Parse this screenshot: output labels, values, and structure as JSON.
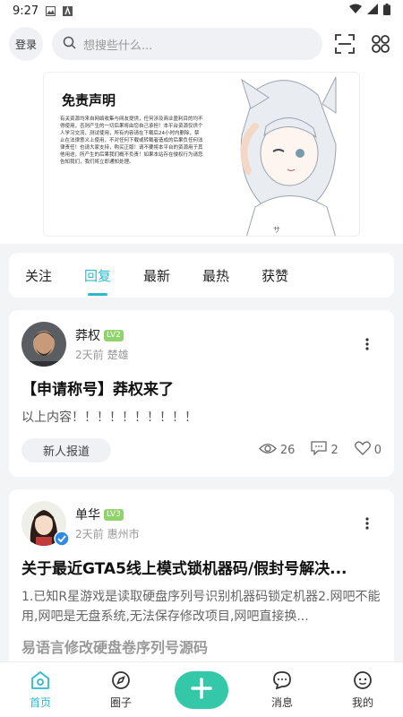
{
  "status": {
    "time": "9:27"
  },
  "header": {
    "login_label": "登录",
    "search_placeholder": "想搜些什么..."
  },
  "banner": {
    "title": "免责声明",
    "body": "有关资源均来自网络收集与网友提供，任何涉及商业盈利目的均不得使用，否则产生的一切后果将由您自己承担！本平台资源仅供个人学习交流、测试使用，所有内容请在下载后24小时内删除，禁止在法律意义上使用，不对任何下载或转载者造成的后果负任何法律责任！也请大家支持，购买正版！请不要将本平台的资源用于其他用途，所产生的后果我们概不负责！如果本站存在侵权行为请您告知我们，我们将立即通知处理。"
  },
  "tabs": [
    {
      "label": "关注"
    },
    {
      "label": "回复"
    },
    {
      "label": "最新"
    },
    {
      "label": "最热"
    },
    {
      "label": "获赞"
    }
  ],
  "active_tab": "回复",
  "posts": [
    {
      "author": "莽权",
      "level": "LV2",
      "time": "2天前",
      "location": "楚雄",
      "title": "【申请称号】莽权来了",
      "body": "以上内容！！！！！！！！！！",
      "tag": "新人报道",
      "views": "26",
      "comments": "2",
      "likes": "0"
    },
    {
      "author": "单华",
      "level": "LV3",
      "time": "2天前",
      "location": "惠州市",
      "title": "关于最近GTA5线上模式锁机器码/假封号解决...",
      "body": "1.已知R星游戏是读取硬盘序列号识别机器码锁定机器2.网吧不能用,网吧是无盘系统,无法保存修改项目,网吧直接换...",
      "subtitle": "易语言修改硬盘卷序列号源码"
    }
  ],
  "bottom_nav": [
    {
      "label": "首页"
    },
    {
      "label": "圈子"
    },
    {
      "label": "消息"
    },
    {
      "label": "我的"
    }
  ],
  "colors": {
    "accent": "#2fb8c9",
    "add_button": "#34c8a8",
    "level_badge": "#8fd46a"
  }
}
